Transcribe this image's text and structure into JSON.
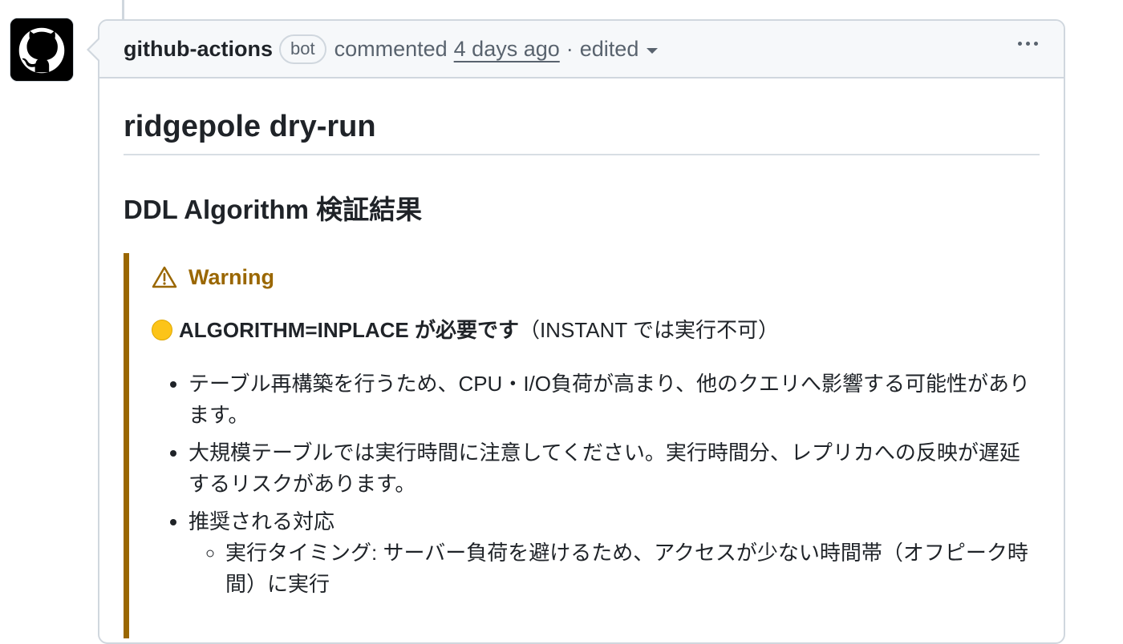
{
  "comment": {
    "author": "github-actions",
    "badge": "bot",
    "action": "commented",
    "time": "4 days ago",
    "separator": "·",
    "edited": "edited",
    "menu_icon": "kebab-horizontal-icon"
  },
  "avatar": {
    "icon": "github-octocat-icon"
  },
  "body": {
    "title": "ridgepole dry-run",
    "subtitle": "DDL Algorithm 検証結果",
    "alert": {
      "icon": "alert-triangle-icon",
      "label": "Warning",
      "lead_icon": "yellow-circle-emoji",
      "lead_strong": "ALGORITHM=INPLACE が必要です",
      "lead_rest": "（INSTANT では実行不可）",
      "bullets": [
        "テーブル再構築を行うため、CPU・I/O負荷が高まり、他のクエリへ影響する可能性があります。",
        "大規模テーブルでは実行時間に注意してください。実行時間分、レプリカへの反映が遅延するリスクがあります。",
        "推奨される対応"
      ],
      "sub_bullets": [
        "実行タイミング: サーバー負荷を避けるため、アクセスが少ない時間帯（オフピーク時間）に実行"
      ]
    }
  },
  "colors": {
    "warning": "#9a6700",
    "border": "#d0d7de",
    "header_bg": "#f6f8fa",
    "muted_text": "#59636e"
  }
}
